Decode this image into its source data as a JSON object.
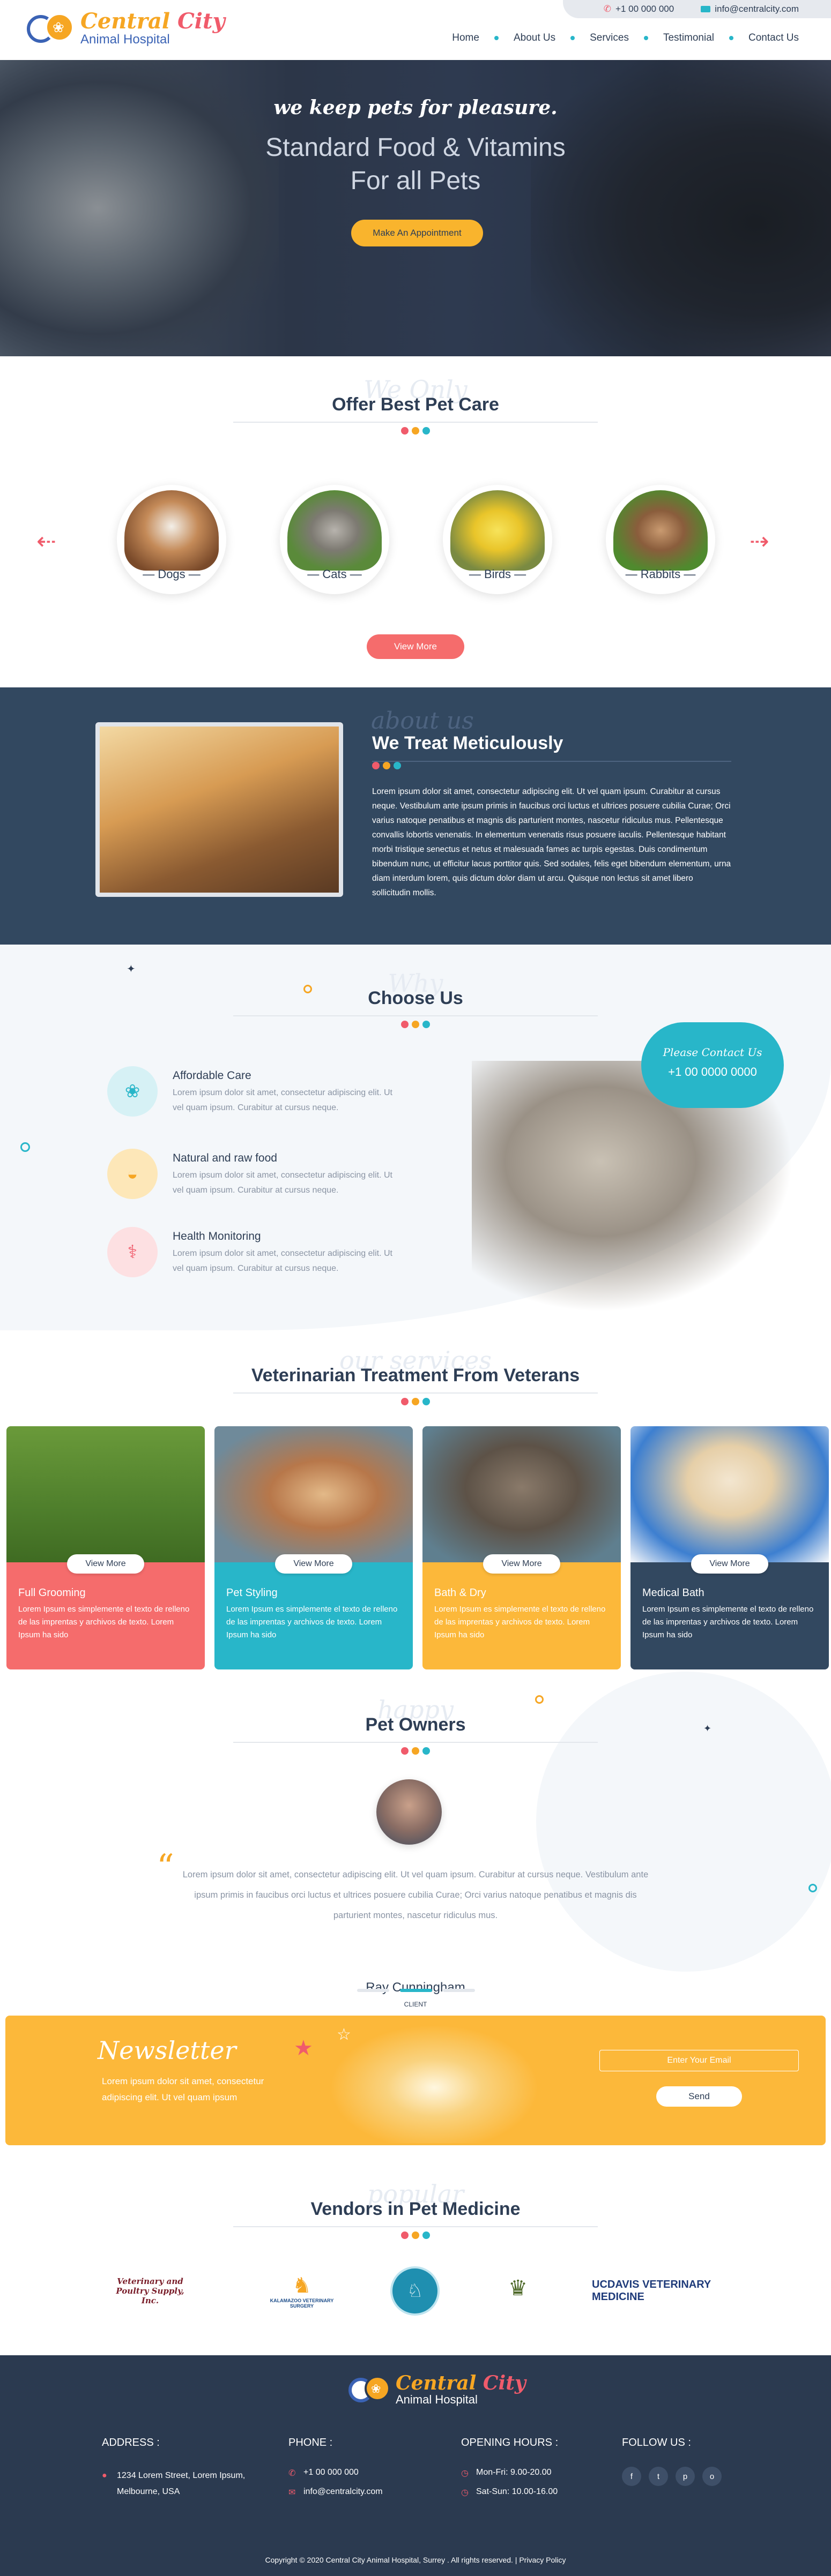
{
  "header": {
    "phone": "+1 00 000 000",
    "email": "info@centralcity.com",
    "logo_title_a": "Central ",
    "logo_title_b": "City",
    "logo_sub": "Animal Hospital",
    "nav": [
      "Home",
      "About Us",
      "Services",
      "Testimonial",
      "Contact Us"
    ]
  },
  "hero": {
    "tagline": "we keep pets for pleasure.",
    "line1": "Standard Food & Vitamins",
    "line2": "For all Pets",
    "button": "Make An Appointment"
  },
  "pet_care": {
    "script": "We Only",
    "title": "Offer Best Pet Care",
    "pets": [
      "Dogs",
      "Cats",
      "Birds",
      "Rabbits"
    ],
    "button": "View More"
  },
  "about": {
    "script": "about us",
    "title": "We Treat Meticulously",
    "text": "Lorem ipsum dolor sit amet, consectetur adipiscing elit. Ut vel quam ipsum. Curabitur at cursus neque. Vestibulum ante ipsum primis in faucibus orci luctus et ultrices posuere cubilia Curae; Orci varius natoque penatibus et magnis dis parturient montes, nascetur ridiculus mus. Pellentesque convallis lobortis venenatis. In elementum venenatis risus posuere iaculis. Pellentesque habitant morbi tristique senectus et netus et malesuada fames ac turpis egestas. Duis condimentum bibendum nunc, ut efficitur lacus porttitor quis. Sed sodales, felis eget bibendum elementum, urna diam interdum lorem, quis dictum dolor diam ut arcu. Quisque non lectus sit amet libero sollicitudin mollis."
  },
  "why": {
    "script": "Why",
    "title": "Choose Us",
    "items": [
      {
        "title": "Affordable Care",
        "text": "Lorem ipsum dolor sit amet, consectetur adipiscing elit. Ut vel quam ipsum. Curabitur at cursus neque."
      },
      {
        "title": "Natural and raw food",
        "text": "Lorem ipsum dolor sit amet, consectetur adipiscing elit. Ut vel quam ipsum. Curabitur at cursus neque."
      },
      {
        "title": "Health Monitoring",
        "text": "Lorem ipsum dolor sit amet, consectetur adipiscing elit. Ut vel quam ipsum. Curabitur at cursus neque."
      }
    ],
    "cloud_title": "Please Contact Us",
    "cloud_phone": "+1 00 0000 0000"
  },
  "services": {
    "script": "our services",
    "title": "Veterinarian Treatment From Veterans",
    "cards": [
      {
        "title": "Full Grooming",
        "button": "View More",
        "text": "Lorem Ipsum es simplemente el texto de relleno de las imprentas y archivos de texto. Lorem Ipsum ha sido",
        "color": "#f56c6c"
      },
      {
        "title": "Pet Styling",
        "button": "View More",
        "text": "Lorem Ipsum es simplemente el texto de relleno de las imprentas y archivos de texto. Lorem Ipsum ha sido",
        "color": "#28b6c9"
      },
      {
        "title": "Bath & Dry",
        "button": "View More",
        "text": "Lorem Ipsum es simplemente el texto de relleno de las imprentas y archivos de texto. Lorem Ipsum ha sido",
        "color": "#fcb83a"
      },
      {
        "title": "Medical Bath",
        "button": "View More",
        "text": "Lorem Ipsum es simplemente el texto de relleno de las imprentas y archivos de texto. Lorem Ipsum ha sido",
        "color": "#324860"
      }
    ]
  },
  "testimonial": {
    "script": "happy",
    "title": "Pet Owners",
    "quote": "Lorem ipsum dolor sit amet, consectetur adipiscing elit. Ut vel quam ipsum. Curabitur at cursus neque. Vestibulum ante ipsum primis in faucibus orci luctus et ultrices posuere cubilia Curae; Orci varius natoque penatibus et magnis dis parturient montes, nascetur ridiculus mus.",
    "name": "Ray Cunningham",
    "role": "CLIENT"
  },
  "newsletter": {
    "title": "Newsletter",
    "text": "Lorem ipsum dolor sit amet, consectetur adipiscing elit. Ut vel quam ipsum",
    "placeholder": "Enter Your Email",
    "button": "Send"
  },
  "vendors": {
    "script": "popular",
    "title": "Vendors in Pet Medicine",
    "logos": [
      "Veterinary and Poultry Supply, Inc.",
      "KALAMAZOO VETERINARY SURGERY",
      "",
      "",
      "UCDAVIS VETERINARY MEDICINE"
    ]
  },
  "footer": {
    "logo_title_a": "Central ",
    "logo_title_b": "City",
    "logo_sub": "Animal Hospital",
    "address_h": "ADDRESS :",
    "address": "1234 Lorem Street, Lorem Ipsum, Melbourne, USA",
    "phone_h": "PHONE :",
    "phone": "+1 00 000 000",
    "email": "info@centralcity.com",
    "hours_h": "OPENING HOURS :",
    "hours1": "Mon-Fri: 9.00-20.00",
    "hours2": "Sat-Sun: 10.00-16.00",
    "follow_h": "FOLLOW US :",
    "social": [
      "f",
      "t",
      "p",
      "o"
    ],
    "copyright": "Copyright © 2020 Central City Animal Hospital, Surrey . All rights reserved. | Privacy Policy"
  }
}
